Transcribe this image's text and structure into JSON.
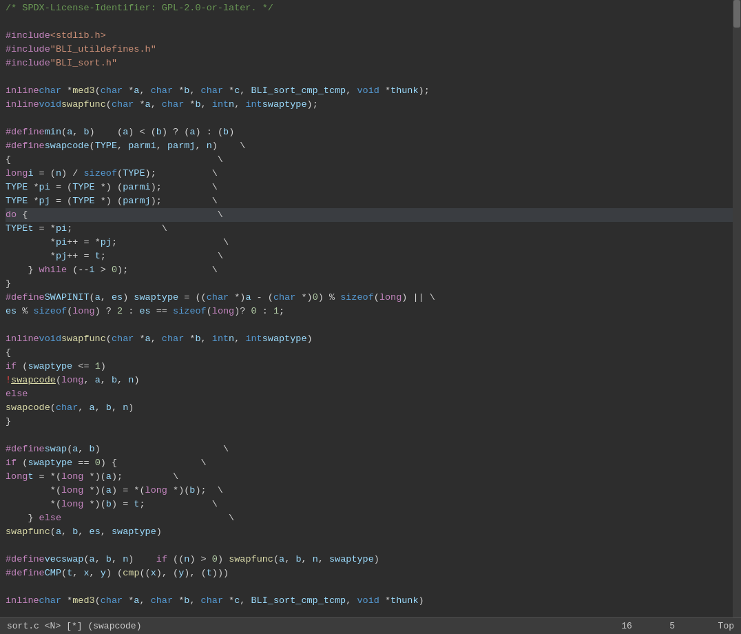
{
  "editor": {
    "lines": [
      {
        "id": 1,
        "html": "<span class='cm'>/* SPDX-License-Identifier: GPL-2.0-or-later. */</span>",
        "highlight": false
      },
      {
        "id": 2,
        "html": "",
        "highlight": false
      },
      {
        "id": 3,
        "html": "<span class='pp'>#include</span> <span class='str'>&lt;stdlib.h&gt;</span>",
        "highlight": false
      },
      {
        "id": 4,
        "html": "<span class='pp'>#include</span> <span class='str'>\"BLI_utildefines.h\"</span>",
        "highlight": false
      },
      {
        "id": 5,
        "html": "<span class='pp'>#include</span> <span class='str'>\"BLI_sort.h\"</span>",
        "highlight": false
      },
      {
        "id": 6,
        "html": "",
        "highlight": false
      },
      {
        "id": 7,
        "html": "<span class='kw'>inline</span> <span class='kw2'>char</span> *<span class='fn'>med3</span>(<span class='kw2'>char</span> *<span class='var'>a</span>, <span class='kw2'>char</span> *<span class='var'>b</span>, <span class='kw2'>char</span> *<span class='var'>c</span>, <span class='var'>BLI_sort_cmp_t</span> <span class='var'>cmp</span>, <span class='kw2'>void</span> *<span class='var'>thunk</span>);",
        "highlight": false
      },
      {
        "id": 8,
        "html": "<span class='kw'>inline</span> <span class='kw2'>void</span>  <span class='fn'>swapfunc</span>(<span class='kw2'>char</span> *<span class='var'>a</span>, <span class='kw2'>char</span> *<span class='var'>b</span>, <span class='kw2'>int</span> <span class='var'>n</span>, <span class='kw2'>int</span> <span class='var'>swaptype</span>);",
        "highlight": false
      },
      {
        "id": 9,
        "html": "",
        "highlight": false
      },
      {
        "id": 10,
        "html": "<span class='pp'>#define</span> <span class='pp-name'>min</span>(<span class='var'>a</span>, <span class='var'>b</span>)    (<span class='var'>a</span>) &lt; (<span class='var'>b</span>) ? (<span class='var'>a</span>) : (<span class='var'>b</span>)",
        "highlight": false
      },
      {
        "id": 11,
        "html": "<span class='pp'>#define</span> <span class='pp-name'>swapcode</span>(<span class='var'>TYPE</span>, <span class='var'>parmi</span>, <span class='var'>parmj</span>, <span class='var'>n</span>)    \\",
        "highlight": false
      },
      {
        "id": 12,
        "html": "<span class='plain'>{</span>                                     \\",
        "highlight": false
      },
      {
        "id": 13,
        "html": "    <span class='kw'>long</span> <span class='var'>i</span> = (<span class='var'>n</span>) / <span class='kw2'>sizeof</span>(<span class='var'>TYPE</span>);          \\",
        "highlight": false
      },
      {
        "id": 14,
        "html": "    <span class='var'>TYPE</span> *<span class='var'>pi</span> = (<span class='var'>TYPE</span> *) (<span class='var'>parmi</span>);         \\",
        "highlight": false
      },
      {
        "id": 15,
        "html": "    <span class='var'>TYPE</span> *<span class='var'>pj</span> = (<span class='var'>TYPE</span> *) (<span class='var'>parmj</span>);         \\",
        "highlight": false
      },
      {
        "id": 16,
        "html": "    <span class='kw'>do</span> {                                  \\",
        "highlight": true
      },
      {
        "id": 17,
        "html": "        <span class='var'>TYPE</span>    <span class='var'>t</span> = *<span class='var'>pi</span>;                \\",
        "highlight": false
      },
      {
        "id": 18,
        "html": "        *<span class='var'>pi</span>++ = *<span class='var'>pj</span>;                   \\",
        "highlight": false
      },
      {
        "id": 19,
        "html": "        *<span class='var'>pj</span>++ = <span class='var'>t</span>;                    \\",
        "highlight": false
      },
      {
        "id": 20,
        "html": "    } <span class='kw'>while</span> (--<span class='var'>i</span> &gt; <span class='num'>0</span>);               \\",
        "highlight": false
      },
      {
        "id": 21,
        "html": "}",
        "highlight": false
      },
      {
        "id": 22,
        "html": "<span class='pp'>#define</span> <span class='pp-name'>SWAPINIT</span>(<span class='var'>a</span>, <span class='var'>es</span>) <span class='var'>swaptype</span> = ((<span class='kw2'>char</span> *)<span class='var'>a</span> - (<span class='kw2'>char</span> *)<span class='num'>0</span>) % <span class='kw2'>sizeof</span>(<span class='kw'>long</span>) || \\",
        "highlight": false
      },
      {
        "id": 23,
        "html": "    <span class='var'>es</span> % <span class='kw2'>sizeof</span>(<span class='kw'>long</span>) ? <span class='num'>2</span> : <span class='var'>es</span> == <span class='kw2'>sizeof</span>(<span class='kw'>long</span>)? <span class='num'>0</span> : <span class='num'>1</span>;",
        "highlight": false
      },
      {
        "id": 24,
        "html": "",
        "highlight": false
      },
      {
        "id": 25,
        "html": "<span class='kw'>inline</span> <span class='kw2'>void</span> <span class='fn'>swapfunc</span>(<span class='kw2'>char</span> *<span class='var'>a</span>, <span class='kw2'>char</span> *<span class='var'>b</span>, <span class='kw2'>int</span> <span class='var'>n</span>, <span class='kw2'>int</span> <span class='var'>swaptype</span>)",
        "highlight": false
      },
      {
        "id": 26,
        "html": "{",
        "highlight": false
      },
      {
        "id": 27,
        "html": "    <span class='kw'>if</span> (<span class='var'>swaptype</span> &lt;= <span class='num'>1</span>)",
        "highlight": false
      },
      {
        "id": 28,
        "html": "<span class='exc'>!</span>       <span class='fn underline'>swapcode</span>(<span class='kw'>long</span>, <span class='var'>a</span>, <span class='var'>b</span>, <span class='var'>n</span>)",
        "highlight": false
      },
      {
        "id": 29,
        "html": "    <span class='kw'>else</span>",
        "highlight": false
      },
      {
        "id": 30,
        "html": "        <span class='fn'>swapcode</span>(<span class='kw2'>char</span>, <span class='var'>a</span>, <span class='var'>b</span>, <span class='var'>n</span>)",
        "highlight": false
      },
      {
        "id": 31,
        "html": "}",
        "highlight": false
      },
      {
        "id": 32,
        "html": "",
        "highlight": false
      },
      {
        "id": 33,
        "html": "<span class='pp'>#define</span> <span class='pp-name'>swap</span>(<span class='var'>a</span>, <span class='var'>b</span>)                      \\",
        "highlight": false
      },
      {
        "id": 34,
        "html": "    <span class='kw'>if</span> (<span class='var'>swaptype</span> == <span class='num'>0</span>) {               \\",
        "highlight": false
      },
      {
        "id": 35,
        "html": "        <span class='kw'>long</span> <span class='var'>t</span> = *(<span class='kw'>long</span> *)(<span class='var'>a</span>);         \\",
        "highlight": false
      },
      {
        "id": 36,
        "html": "        *(<span class='kw'>long</span> *)(<span class='var'>a</span>) = *(<span class='kw'>long</span> *)(<span class='var'>b</span>);  \\",
        "highlight": false
      },
      {
        "id": 37,
        "html": "        *(<span class='kw'>long</span> *)(<span class='var'>b</span>) = <span class='var'>t</span>;            \\",
        "highlight": false
      },
      {
        "id": 38,
        "html": "    } <span class='kw'>else</span>                              \\",
        "highlight": false
      },
      {
        "id": 39,
        "html": "        <span class='fn'>swapfunc</span>(<span class='var'>a</span>, <span class='var'>b</span>, <span class='var'>es</span>, <span class='var'>swaptype</span>)",
        "highlight": false
      },
      {
        "id": 40,
        "html": "",
        "highlight": false
      },
      {
        "id": 41,
        "html": "<span class='pp'>#define</span> <span class='pp-name'>vecswap</span>(<span class='var'>a</span>, <span class='var'>b</span>, <span class='var'>n</span>)    <span class='kw'>if</span> ((<span class='var'>n</span>) &gt; <span class='num'>0</span>) <span class='fn'>swapfunc</span>(<span class='var'>a</span>, <span class='var'>b</span>, <span class='var'>n</span>, <span class='var'>swaptype</span>)",
        "highlight": false
      },
      {
        "id": 42,
        "html": "<span class='pp'>#define</span> <span class='pp-name'>CMP</span>(<span class='var'>t</span>, <span class='var'>x</span>, <span class='var'>y</span>) (<span class='fn'>cmp</span>((<span class='var'>x</span>), (<span class='var'>y</span>), (<span class='var'>t</span>)))",
        "highlight": false
      },
      {
        "id": 43,
        "html": "",
        "highlight": false
      },
      {
        "id": 44,
        "html": "<span class='kw'>inline</span> <span class='kw2'>char</span> *<span class='fn'>med3</span>(<span class='kw2'>char</span> *<span class='var'>a</span>, <span class='kw2'>char</span> *<span class='var'>b</span>, <span class='kw2'>char</span> *<span class='var'>c</span>, <span class='var'>BLI_sort_cmp_t</span> <span class='var'>cmp</span>, <span class='kw2'>void</span> *<span class='var'>thunk</span>)",
        "highlight": false
      }
    ],
    "status": {
      "filename": "sort.c",
      "mode": "<N>",
      "extra": "[*] (swapcode)",
      "line": "16",
      "col": "5",
      "position": "Top"
    }
  }
}
